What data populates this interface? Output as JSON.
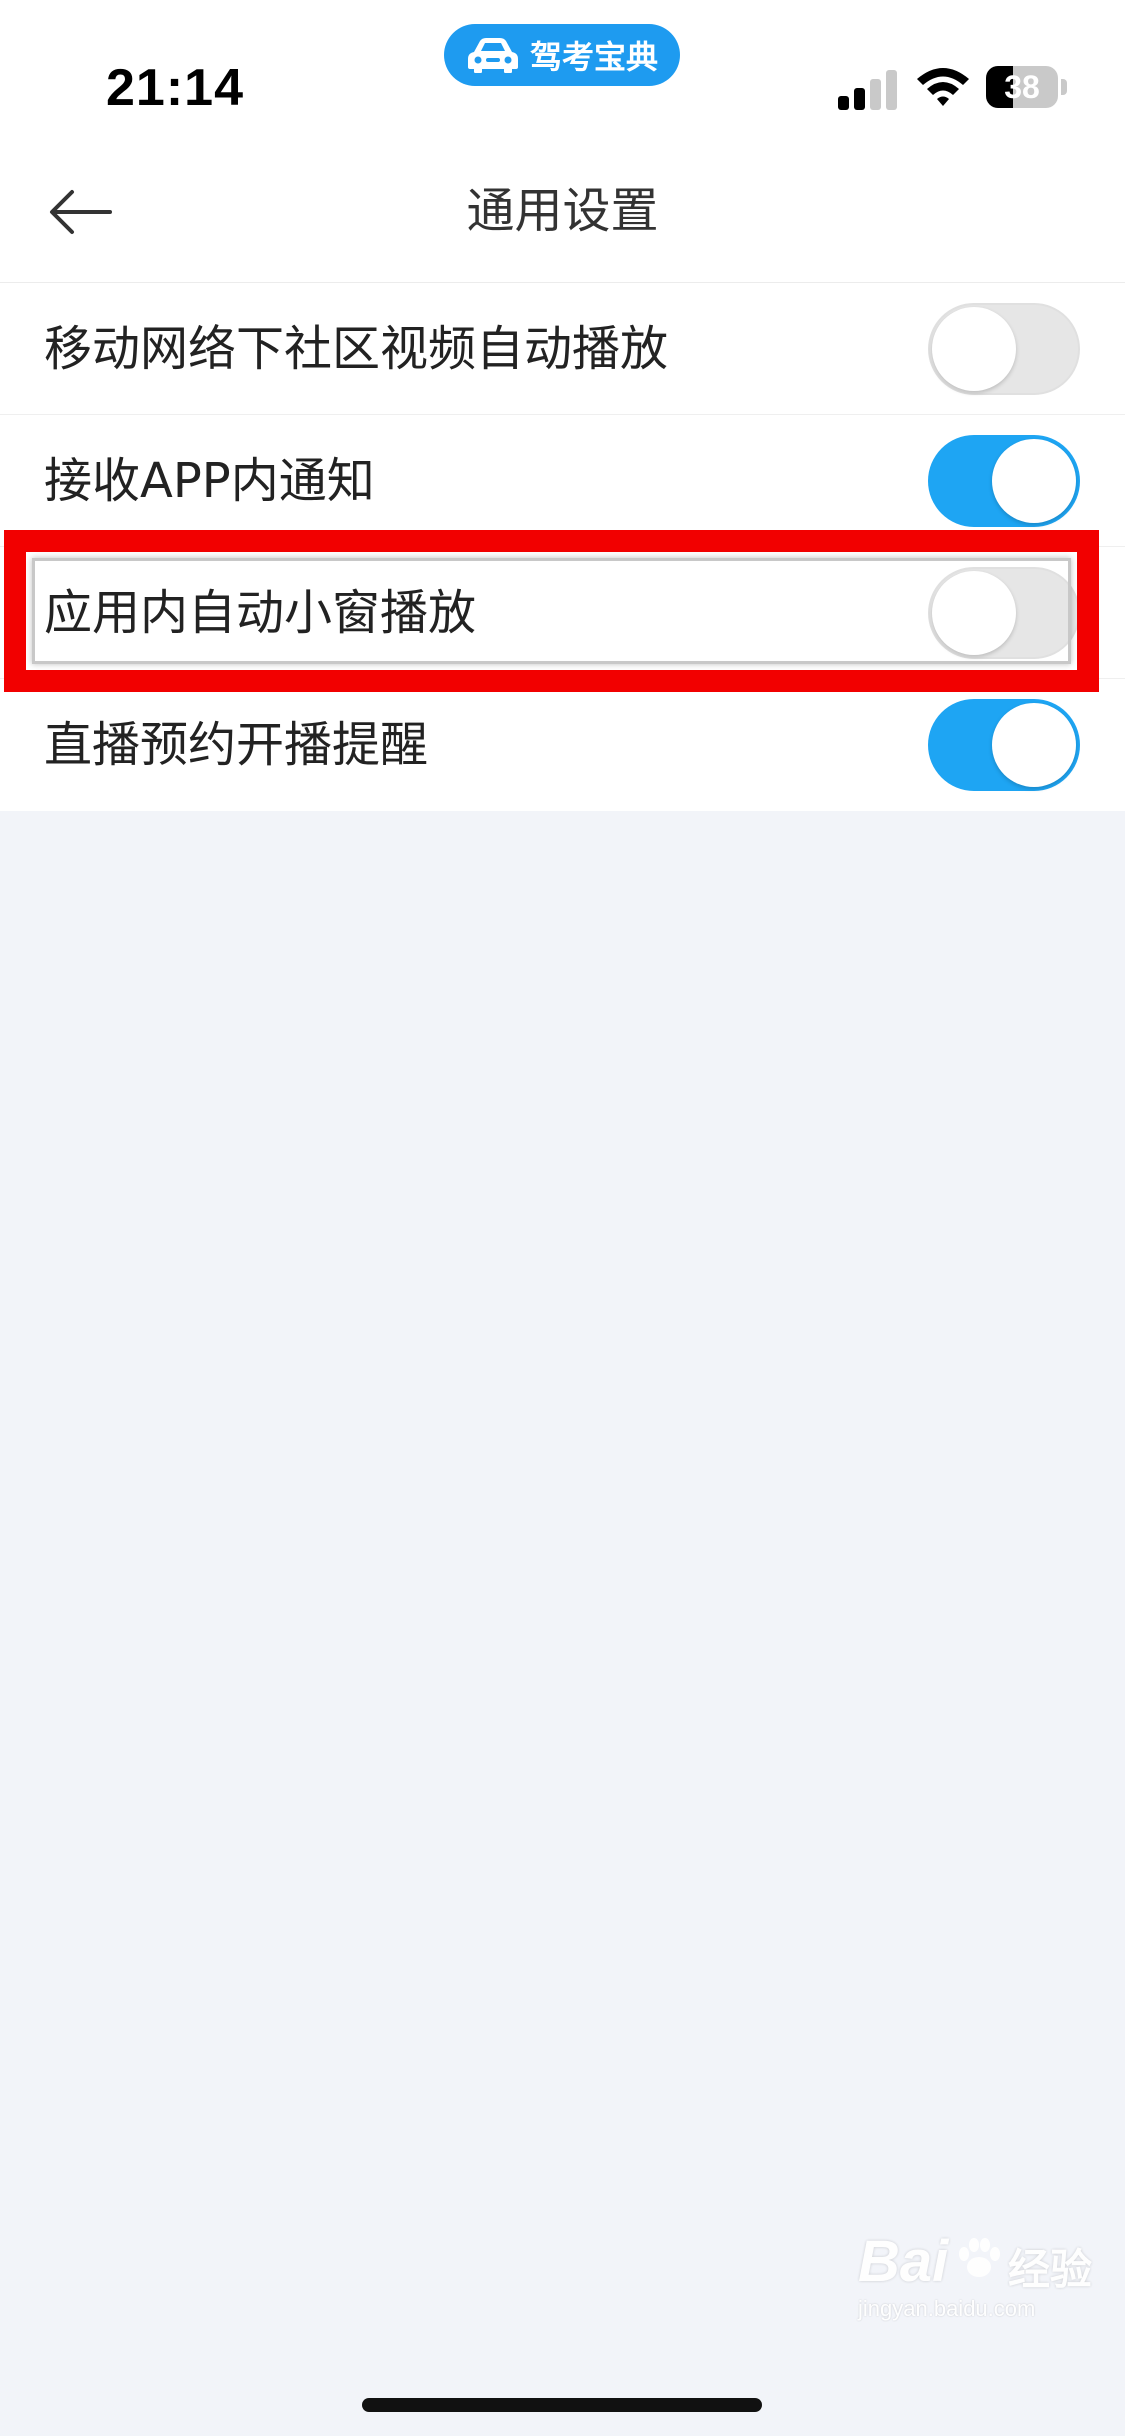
{
  "status_bar": {
    "time": "21:14",
    "app_badge": "驾考宝典",
    "battery_level": "38",
    "battery_fraction": 0.38,
    "icons": [
      "car-icon",
      "signal-icon",
      "wifi-icon",
      "battery-icon"
    ]
  },
  "nav": {
    "title": "通用设置",
    "back_icon": "arrow-left-icon"
  },
  "settings": {
    "items": [
      {
        "label": "移动网络下社区视频自动播放",
        "enabled": false
      },
      {
        "label": "接收APP内通知",
        "enabled": true
      },
      {
        "label": "应用内自动小窗播放",
        "enabled": false
      },
      {
        "label": "直播预约开播提醒",
        "enabled": true
      }
    ]
  },
  "annotation": {
    "highlight_color": "#f20000",
    "highlighted_index": 2
  },
  "watermark": {
    "brand": "Bai",
    "brand_suffix": "经验",
    "url": "jingyan.baidu.com"
  },
  "colors": {
    "accent": "#1ea5f3",
    "app_badge": "#1e9bf0",
    "background": "#f2f4f9"
  }
}
